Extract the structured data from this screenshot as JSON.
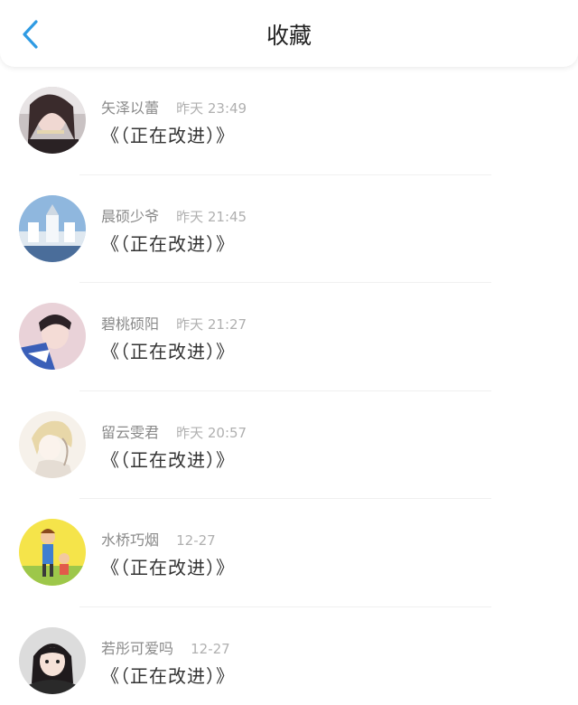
{
  "header": {
    "title": "收藏",
    "back_icon": "chevron-left-icon",
    "accent_color": "#2f9be3"
  },
  "favorites": [
    {
      "name": "矢泽以蕾",
      "time": "昨天 23:49",
      "content": "《（正在改进）》",
      "avatar": "girl-selfie-avatar"
    },
    {
      "name": "晨硕少爷",
      "time": "昨天 21:45",
      "content": "《（正在改进）》",
      "avatar": "snow-castle-avatar"
    },
    {
      "name": "碧桃硕阳",
      "time": "昨天 21:27",
      "content": "《（正在改进）》",
      "avatar": "boy-photo-avatar"
    },
    {
      "name": "留云雯君",
      "time": "昨天 20:57",
      "content": "《（正在改进）》",
      "avatar": "anime-sketch-avatar"
    },
    {
      "name": "水桥巧烟",
      "time": "12-27",
      "content": "《（正在改进）》",
      "avatar": "cartoon-kids-avatar"
    },
    {
      "name": "若彤可爱吗",
      "time": "12-27",
      "content": "《（正在改进）》",
      "avatar": "girl-portrait-avatar"
    }
  ]
}
